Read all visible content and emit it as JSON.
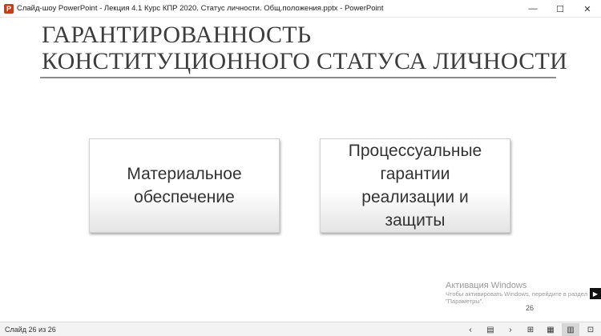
{
  "window": {
    "title": "Слайд-шоу PowerPoint  -  Лекция 4.1 Курс КПР 2020. Статус личности. Общ.положения.pptx - PowerPoint",
    "controls": {
      "minimize": "—",
      "maximize": "☐",
      "close": "✕"
    }
  },
  "slide": {
    "title": "ГАРАНТИРОВАННОСТЬ КОНСТИТУЦИОННОГО СТАТУСА ЛИЧНОСТИ",
    "boxes": [
      {
        "text": "Материальное\nобеспечение"
      },
      {
        "text": "Процессуальные\nгарантии\nреализации и\nзащиты"
      }
    ],
    "slide_number": "26"
  },
  "watermark": {
    "title": "Активация Windows",
    "text": "Чтобы активировать Windows, перейдите в раздел\n\"Параметры\"."
  },
  "statusbar": {
    "slide_counter": "Слайд 26 из 26",
    "icons": [
      "chevron-left-icon",
      "notes-icon",
      "chevron-right-icon",
      "grid-icon",
      "grid2-icon",
      "reading-view-icon",
      "slideshow-icon"
    ]
  },
  "colors": {
    "title_text": "#3d3d3d",
    "app_icon": "#c43e1c"
  }
}
